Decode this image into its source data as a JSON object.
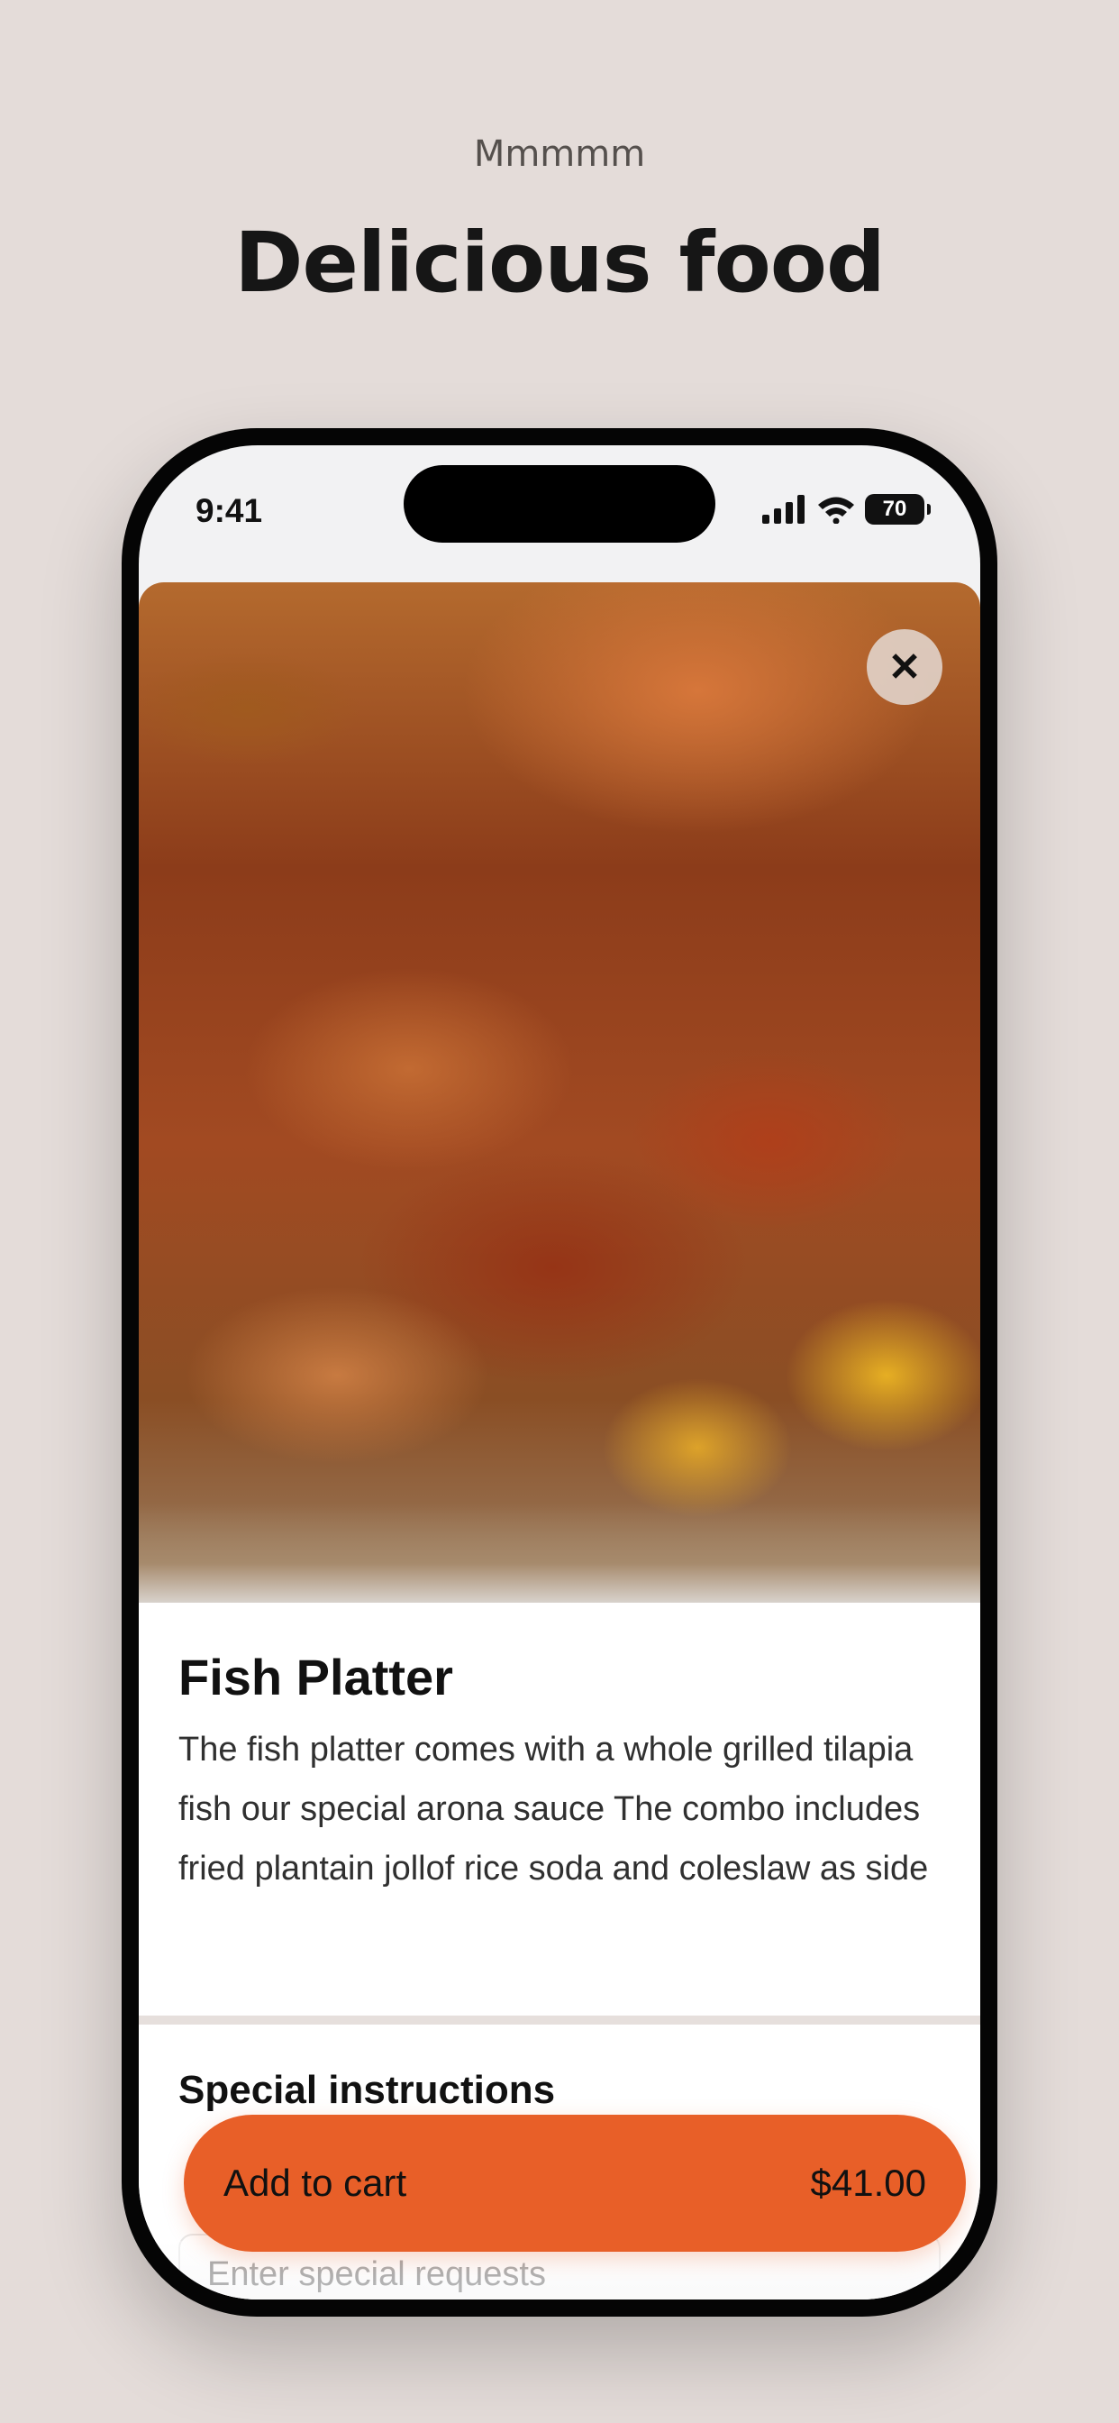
{
  "page": {
    "eyebrow": "Mmmmm",
    "headline": "Delicious food"
  },
  "status_bar": {
    "time": "9:41",
    "battery": "70"
  },
  "item": {
    "title": "Fish Platter",
    "description": "The fish platter comes with a whole grilled tilapia fish our special arona sauce The combo includes fried plantain jollof rice soda and coleslaw as side",
    "close_icon": "✕"
  },
  "special_instructions": {
    "label": "Special instructions",
    "placeholder": "Enter special requests"
  },
  "cart": {
    "label": "Add to cart",
    "price": "$41.00"
  },
  "colors": {
    "accent": "#e85f28",
    "background": "#e4dcd9"
  }
}
